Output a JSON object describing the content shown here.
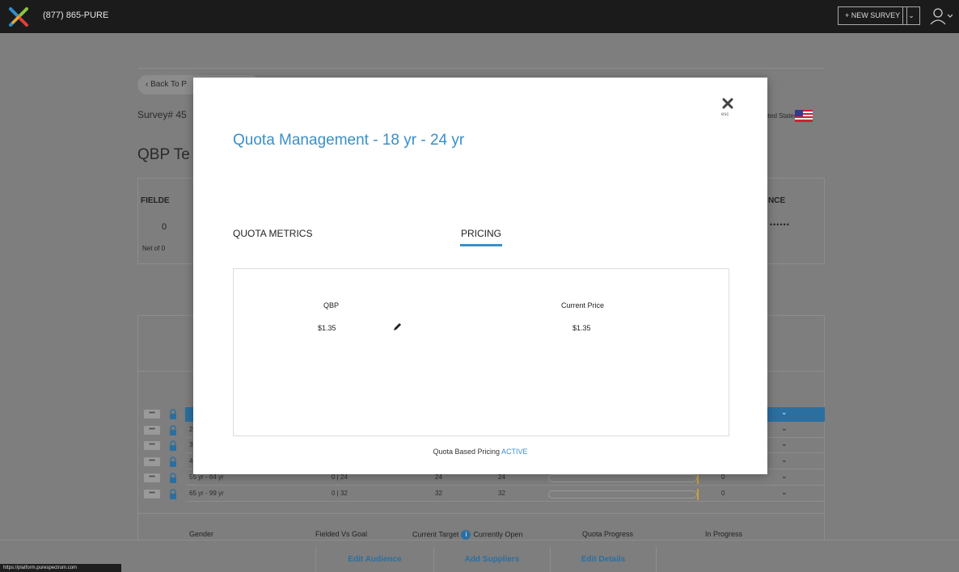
{
  "topbar": {
    "phone": "(877) 865-PURE",
    "new_survey": "+ NEW SURVEY",
    "caret": "⌄"
  },
  "page": {
    "back_button": "‹ Back To P",
    "survey_number": "Survey# 45",
    "title": "QBP Te",
    "country": "ited States",
    "fielded_label": "FIELDE",
    "fielded_value": "0",
    "net_of": "Net of 0",
    "nce_label": "NCE",
    "masked": "••••••"
  },
  "quota_rows": [
    {
      "options": "•••",
      "age": "",
      "fielded_vs_goal": "",
      "current_target": "",
      "currently_open": "",
      "in_progress": "",
      "active": true
    },
    {
      "options": "•••",
      "age": "2",
      "fielded_vs_goal": "",
      "current_target": "",
      "currently_open": "",
      "in_progress": "",
      "active": false
    },
    {
      "options": "•••",
      "age": "3",
      "fielded_vs_goal": "",
      "current_target": "",
      "currently_open": "",
      "in_progress": "",
      "active": false
    },
    {
      "options": "•••",
      "age": "4",
      "fielded_vs_goal": "",
      "current_target": "",
      "currently_open": "",
      "in_progress": "",
      "active": false
    },
    {
      "options": "•••",
      "age": "55 yr - 64 yr",
      "fielded_vs_goal": "0 | 24",
      "current_target": "24",
      "currently_open": "24",
      "in_progress": "0",
      "active": false
    },
    {
      "options": "•••",
      "age": "65 yr - 99 yr",
      "fielded_vs_goal": "0 | 32",
      "current_target": "32",
      "currently_open": "32",
      "in_progress": "0",
      "active": false
    }
  ],
  "gender_header": {
    "gender": "Gender",
    "fielded_vs_goal": "Fielded Vs Goal",
    "current_target": "Current Target",
    "info": "i",
    "currently_open": "Currently Open",
    "quota_progress": "Quota Progress",
    "in_progress": "In Progress"
  },
  "bottom_bar": {
    "edit_audience": "Edit Audience",
    "add_suppliers": "Add Suppliers",
    "edit_details": "Edit Details",
    "status_url": "https://platform.purespectrum.com"
  },
  "modal": {
    "esc": "esc",
    "title": "Quota Management - 18 yr - 24 yr",
    "tabs": [
      {
        "label": "QUOTA METRICS",
        "selected": false
      },
      {
        "label": "PRICING",
        "selected": true
      }
    ],
    "qbp_label": "QBP",
    "qbp_value": "$1.35",
    "current_price_label": "Current Price",
    "current_price_value": "$1.35",
    "status_prefix": "Quota Based Pricing",
    "status_value": "ACTIVE"
  },
  "colors": {
    "accent": "#3a8fc9",
    "active_row": "#2b6fa0",
    "topbar": "#1b1b1b",
    "progress_marker": "#c9a233"
  }
}
